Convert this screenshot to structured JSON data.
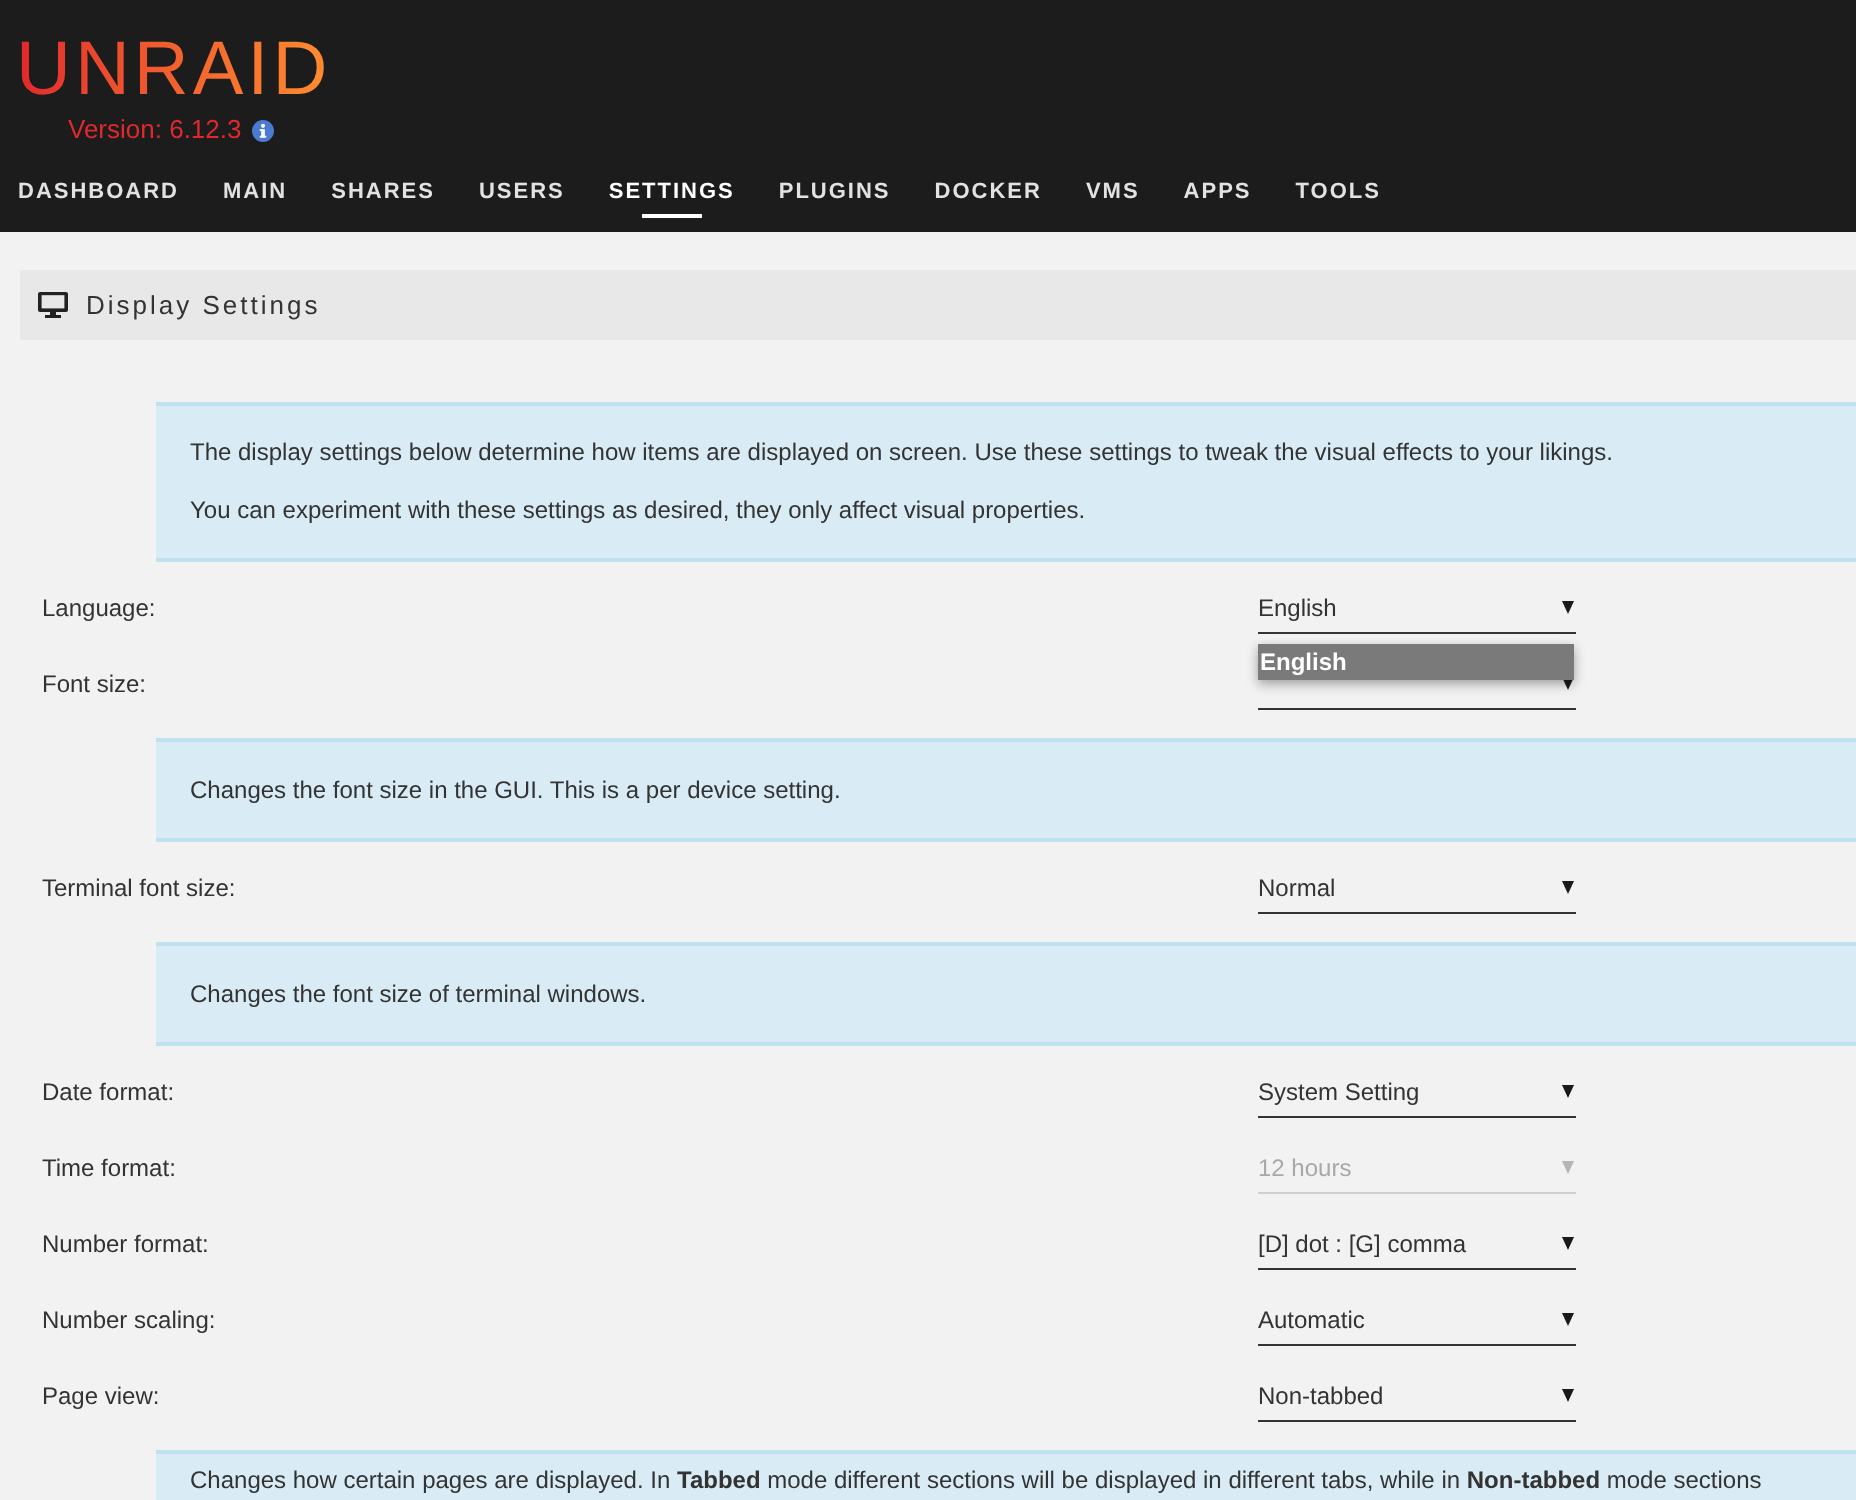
{
  "header": {
    "logo": "UNRAID",
    "version": "Version: 6.12.3"
  },
  "nav": [
    {
      "label": "DASHBOARD",
      "selected": false
    },
    {
      "label": "MAIN",
      "selected": false
    },
    {
      "label": "SHARES",
      "selected": false
    },
    {
      "label": "USERS",
      "selected": false
    },
    {
      "label": "SETTINGS",
      "selected": true
    },
    {
      "label": "PLUGINS",
      "selected": false
    },
    {
      "label": "DOCKER",
      "selected": false
    },
    {
      "label": "VMS",
      "selected": false
    },
    {
      "label": "APPS",
      "selected": false
    },
    {
      "label": "TOOLS",
      "selected": false
    }
  ],
  "section": {
    "title": "Display Settings"
  },
  "blocks": [
    {
      "kind": "info",
      "lines": [
        "The display settings below determine how items are displayed on screen. Use these settings to tweak the visual effects to your likings.",
        "You can experiment with these settings as desired, they only affect visual properties."
      ]
    },
    {
      "kind": "setting",
      "label": "Language:",
      "value": "English",
      "disabled": false,
      "open_menu": {
        "options": [
          {
            "label": "English",
            "selected": true
          }
        ]
      }
    },
    {
      "kind": "setting",
      "label": "Font size:",
      "disabled": false
    },
    {
      "kind": "info",
      "lines": [
        "Changes the font size in the GUI. This is a per device setting."
      ]
    },
    {
      "kind": "setting",
      "label": "Terminal font size:",
      "value": "Normal",
      "disabled": false
    },
    {
      "kind": "info",
      "lines": [
        "Changes the font size of terminal windows."
      ]
    },
    {
      "kind": "setting",
      "label": "Date format:",
      "value": "System Setting",
      "disabled": false
    },
    {
      "kind": "setting",
      "label": "Time format:",
      "value": "12 hours",
      "disabled": true
    },
    {
      "kind": "setting",
      "label": "Number format:",
      "value": "[D] dot : [G] comma",
      "disabled": false
    },
    {
      "kind": "setting",
      "label": "Number scaling:",
      "value": "Automatic",
      "disabled": false
    },
    {
      "kind": "setting",
      "label": "Page view:",
      "value": "Non-tabbed",
      "disabled": false
    },
    {
      "kind": "info",
      "lines": [
        "Changes how certain pages are displayed. In **Tabbed** mode different sections will be displayed in different tabs, while in **Non-tabbed** mode sections"
      ]
    }
  ]
}
